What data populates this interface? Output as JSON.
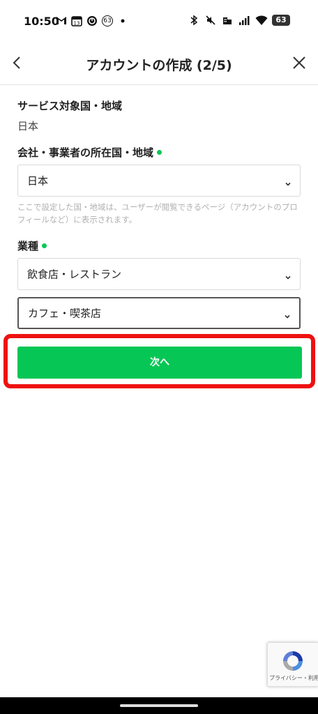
{
  "status_bar": {
    "time": "10:50",
    "left_icons": [
      "gmail-icon",
      "calendar-icon",
      "timer-icon",
      "notification-badge",
      "dot-icon"
    ],
    "badge_number": "63",
    "battery": "63",
    "calendar_day": "13"
  },
  "header": {
    "title": "アカウントの作成 (2/5)"
  },
  "form": {
    "service_country": {
      "label": "サービス対象国・地域",
      "value": "日本"
    },
    "company_country": {
      "label": "会社・事業者の所在国・地域",
      "selected": "日本",
      "help": "ここで設定した国・地域は、ユーザーが閲覧できるページ（アカウントのプロフィールなど）に表示されます。"
    },
    "industry": {
      "label": "業種",
      "primary_selected": "飲食店・レストラン",
      "secondary_selected": "カフェ・喫茶店"
    }
  },
  "next_button": {
    "label": "次へ"
  },
  "recaptcha": {
    "links": "プライバシー・利用規約"
  },
  "colors": {
    "accent_green": "#06c755",
    "highlight_red": "#ee1111",
    "nav_bar": "#000000"
  }
}
